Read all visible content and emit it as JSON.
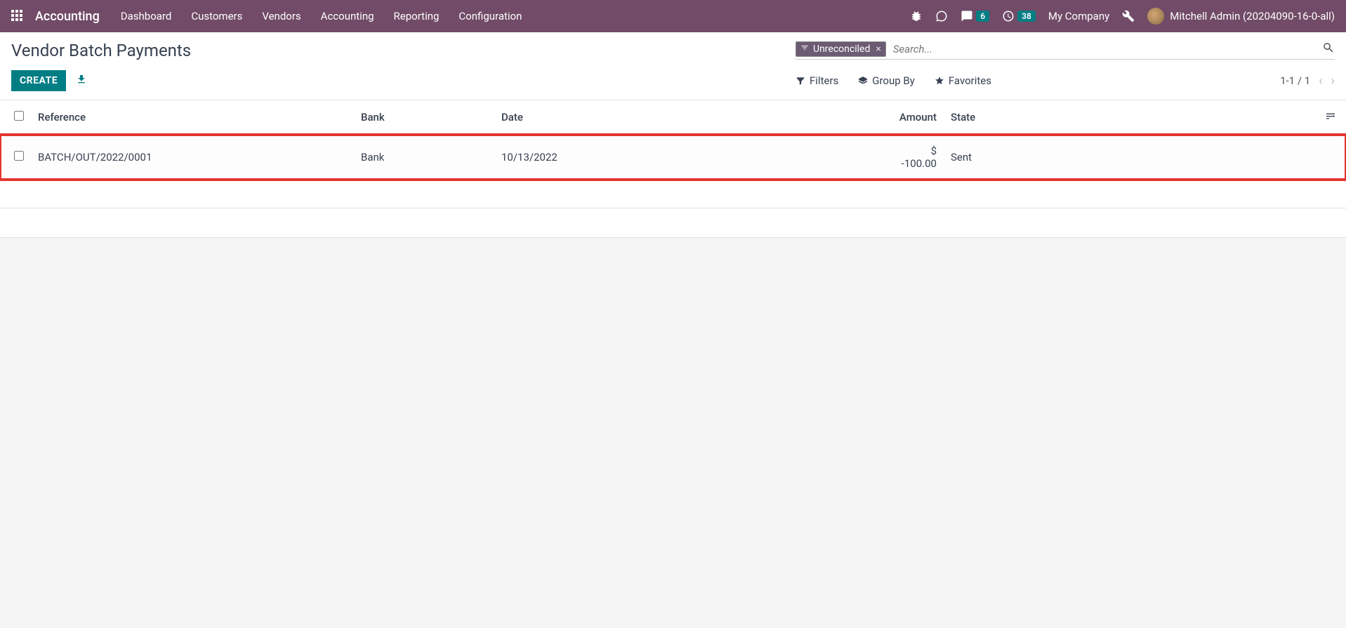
{
  "topnav": {
    "app_title": "Accounting",
    "links": [
      "Dashboard",
      "Customers",
      "Vendors",
      "Accounting",
      "Reporting",
      "Configuration"
    ],
    "messages_badge": "6",
    "activities_badge": "38",
    "company": "My Company",
    "user": "Mitchell Admin (20204090-16-0-all)"
  },
  "breadcrumb": "Vendor Batch Payments",
  "search": {
    "filter_tag": "Unreconciled",
    "placeholder": "Search...",
    "filters_label": "Filters",
    "groupby_label": "Group By",
    "favorites_label": "Favorites"
  },
  "buttons": {
    "create": "CREATE"
  },
  "pager": {
    "range": "1-1 / 1"
  },
  "table": {
    "headers": {
      "reference": "Reference",
      "bank": "Bank",
      "date": "Date",
      "amount": "Amount",
      "state": "State"
    },
    "rows": [
      {
        "reference": "BATCH/OUT/2022/0001",
        "bank": "Bank",
        "date": "10/13/2022",
        "amount": "$ -100.00",
        "state": "Sent"
      }
    ]
  }
}
